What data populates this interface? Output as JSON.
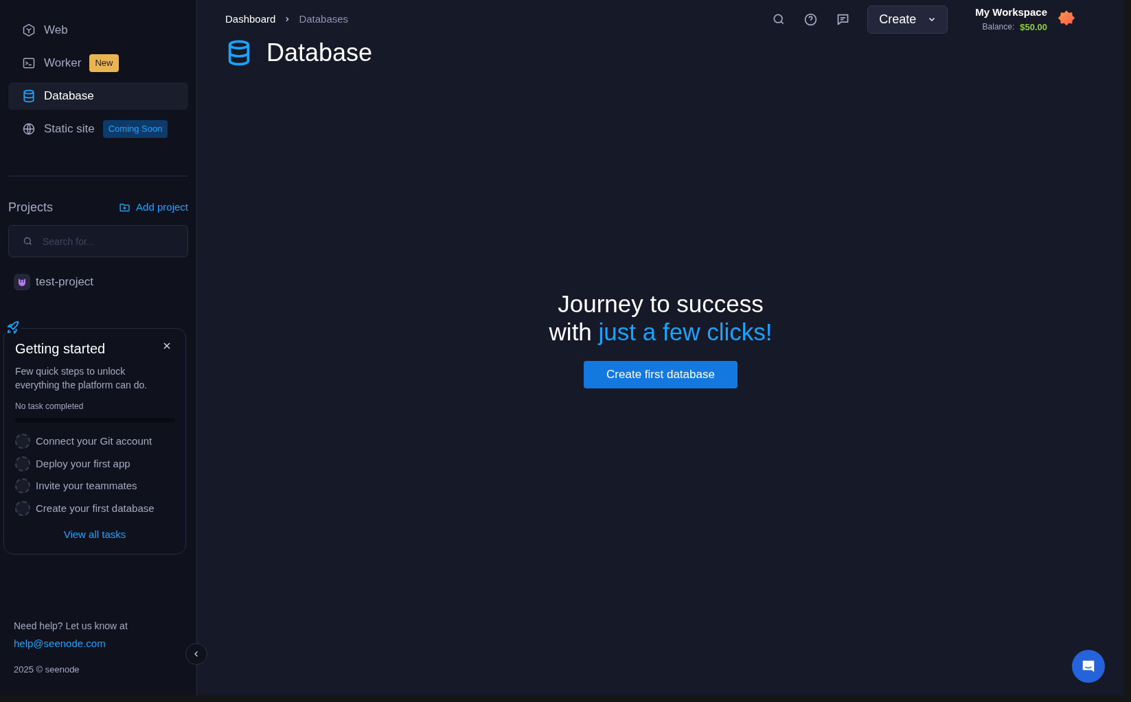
{
  "sidebar": {
    "nav": [
      {
        "label": "Web",
        "selected": false
      },
      {
        "label": "Worker",
        "selected": false,
        "badge": {
          "text": "New",
          "kind": "new"
        }
      },
      {
        "label": "Database",
        "selected": true
      },
      {
        "label": "Static site",
        "selected": false,
        "badge": {
          "text": "Coming Soon",
          "kind": "soon"
        }
      }
    ],
    "projects": {
      "title": "Projects",
      "add_label": "Add project",
      "search": {
        "placeholder": "Search for..."
      },
      "items": [
        {
          "name": "test-project"
        }
      ]
    },
    "getting_started": {
      "title": "Getting started",
      "description": "Few quick steps to unlock everything the platform can do.",
      "progress_label": "No task completed",
      "level": 0,
      "tasks": [
        {
          "label": "Connect your Git account",
          "done": false
        },
        {
          "label": "Deploy your first app",
          "done": false
        },
        {
          "label": "Invite your teammates",
          "done": false
        },
        {
          "label": "Create your first database",
          "done": false
        }
      ],
      "link": "View all tasks"
    },
    "help_text": "Need help? Let us know at",
    "help_email": "help@seenode.com",
    "copyright": "2025 © seenode"
  },
  "header": {
    "breadcrumb": [
      {
        "label": "Dashboard"
      },
      {
        "label": "Databases"
      }
    ],
    "create_button": "Create",
    "workspace": {
      "name": "My Workspace",
      "balance_label": "Balance:",
      "balance": "$50.00"
    }
  },
  "page": {
    "title": "Database",
    "headline_line1": "Journey to success",
    "headline_line2_prefix": "with",
    "headline_line2_highlight": "just a few clicks!",
    "cta": "Create first database"
  }
}
